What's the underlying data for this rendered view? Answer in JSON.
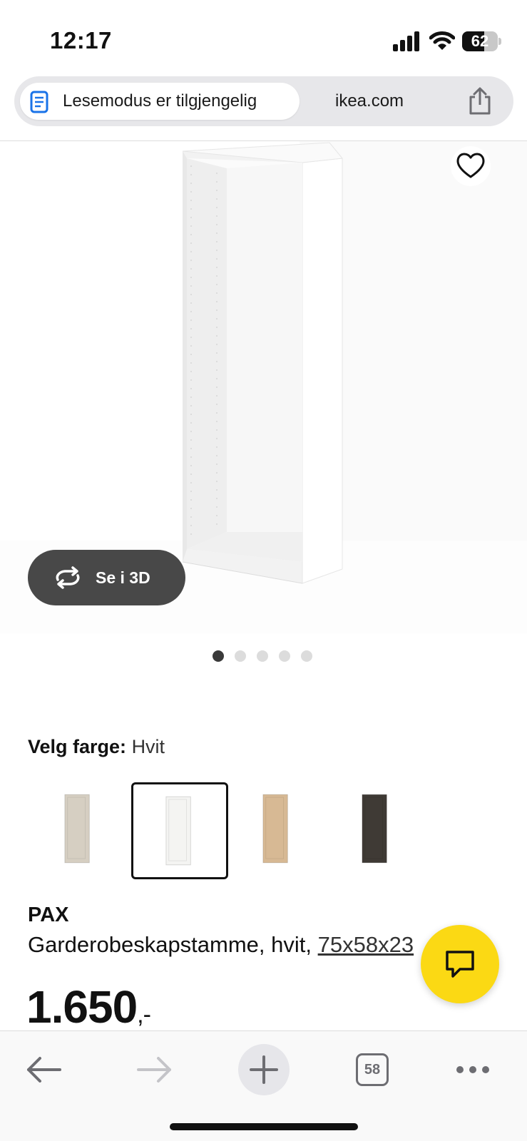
{
  "status_bar": {
    "time": "12:17",
    "battery_level": "62",
    "battery_fraction": 0.62
  },
  "address_bar": {
    "reader_mode_label": "Lesemodus er tilgjengelig",
    "domain": "ikea.com",
    "icons": {
      "reader": "reader-mode-icon",
      "share": "share-icon"
    }
  },
  "product_gallery": {
    "see_3d_label": "Se i 3D",
    "image_count": 5,
    "active_image": 1,
    "icons": {
      "favorite": "heart-icon",
      "rotate": "rotate-3d-icon"
    }
  },
  "color_picker": {
    "label": "Velg farge:",
    "selected_value": "Hvit",
    "options": [
      {
        "color": "#d6cfc2",
        "selected": false
      },
      {
        "color": "#f4f4f2",
        "selected": true
      },
      {
        "color": "#d7b994",
        "selected": false
      },
      {
        "color": "#3f3a35",
        "selected": false
      }
    ]
  },
  "product": {
    "name": "PAX",
    "description": "Garderobeskapstamme, hvit, ",
    "size": "75x58x23",
    "price": "1.650",
    "price_suffix": ",-"
  },
  "chat": {
    "icon": "chat-bubble-icon",
    "color": "#fbd914"
  },
  "toolbar": {
    "tab_count": "58",
    "icons": {
      "back": "back-arrow-icon",
      "forward": "forward-arrow-icon",
      "new_tab": "plus-icon",
      "tabs": "tabs-icon",
      "more": "more-icon"
    }
  }
}
